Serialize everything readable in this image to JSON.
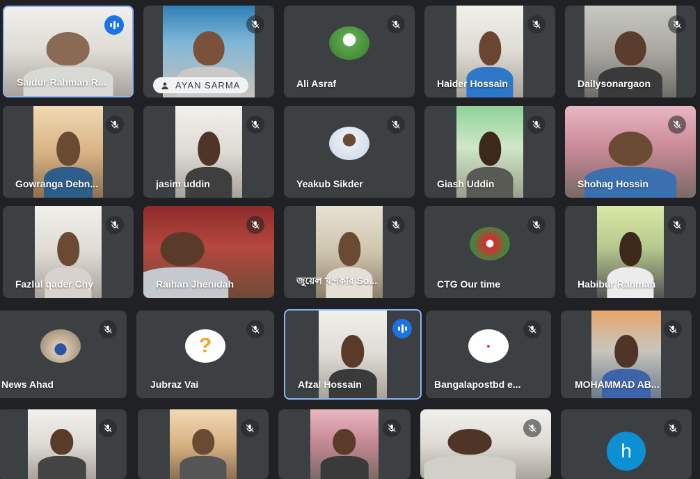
{
  "participants": {
    "saidur": {
      "name": "Saidur Rahman R..."
    },
    "ayan": {
      "name": "AYAN SARMA"
    },
    "ali": {
      "name": "Ali Asraf"
    },
    "haider": {
      "name": "Haider Hossain"
    },
    "daily": {
      "name": "Dailysonargaon"
    },
    "gowranga": {
      "name": "Gowranga Debn..."
    },
    "jasim": {
      "name": "jasim uddin"
    },
    "yeakub": {
      "name": "Yeakub Sikder"
    },
    "giash": {
      "name": "Giash Uddin"
    },
    "shohag": {
      "name": "Shohag Hossin"
    },
    "fazlul": {
      "name": "Fazlul qader Chy"
    },
    "raihan": {
      "name": "Raihan Jhenidah"
    },
    "jewel": {
      "name": "জুয়েল খন্দকার So..."
    },
    "ctg": {
      "name": "CTG Our time"
    },
    "habibur": {
      "name": "Habibur Rahman"
    },
    "news": {
      "name": "News Ahad"
    },
    "jubraz": {
      "name": "Jubraz Vai"
    },
    "afzal": {
      "name": "Afzal Hossain"
    },
    "bangla": {
      "name": "Bangalapostbd e..."
    },
    "mohammad": {
      "name": "MOHAMMAD AB..."
    },
    "h": {
      "letter": "h"
    }
  },
  "colors": {
    "background": "#202124",
    "tile": "#3c4043",
    "speaking_border": "#8ab4f8",
    "speaking_badge": "#1a73e8"
  },
  "icons": {
    "muted": "mic-off-icon",
    "speaking": "audio-level-icon",
    "presenter": "person-icon"
  }
}
